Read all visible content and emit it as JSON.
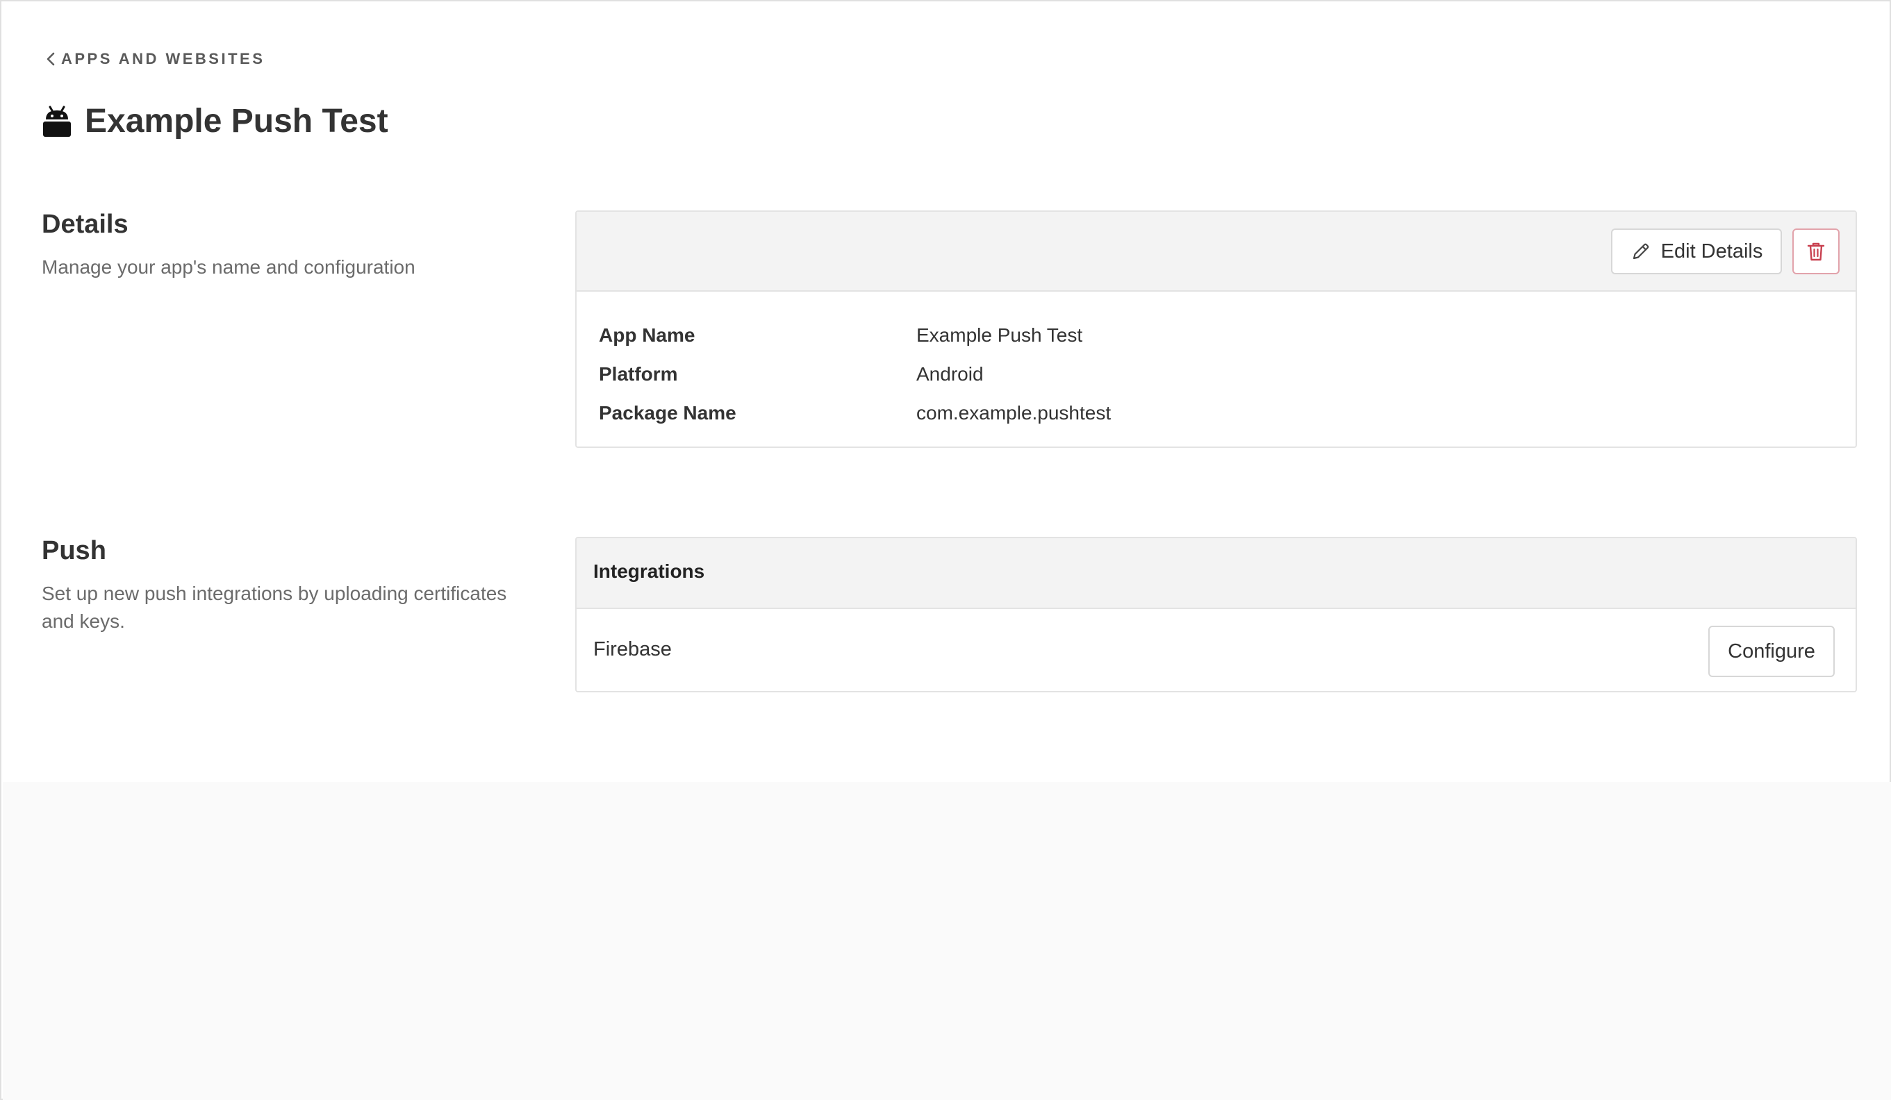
{
  "breadcrumb": {
    "label": "APPS AND WEBSITES"
  },
  "page": {
    "title": "Example Push Test",
    "platform_icon": "android-icon"
  },
  "details_section": {
    "title": "Details",
    "description": "Manage your app's name and configuration",
    "edit_button_label": "Edit Details",
    "edit_icon": "pencil-icon",
    "delete_icon": "trash-icon",
    "rows": [
      {
        "label": "App Name",
        "value": "Example Push Test"
      },
      {
        "label": "Platform",
        "value": "Android"
      },
      {
        "label": "Package Name",
        "value": "com.example.pushtest"
      }
    ]
  },
  "push_section": {
    "title": "Push",
    "description": "Set up new push integrations by uploading certificates and keys.",
    "card_title": "Integrations",
    "integrations": [
      {
        "name": "Firebase",
        "action_label": "Configure"
      }
    ]
  },
  "colors": {
    "text": "#333333",
    "muted": "#6b6b6b",
    "card_header_bg": "#f3f3f3",
    "border": "#e3e3e3",
    "danger": "#c8404f"
  }
}
